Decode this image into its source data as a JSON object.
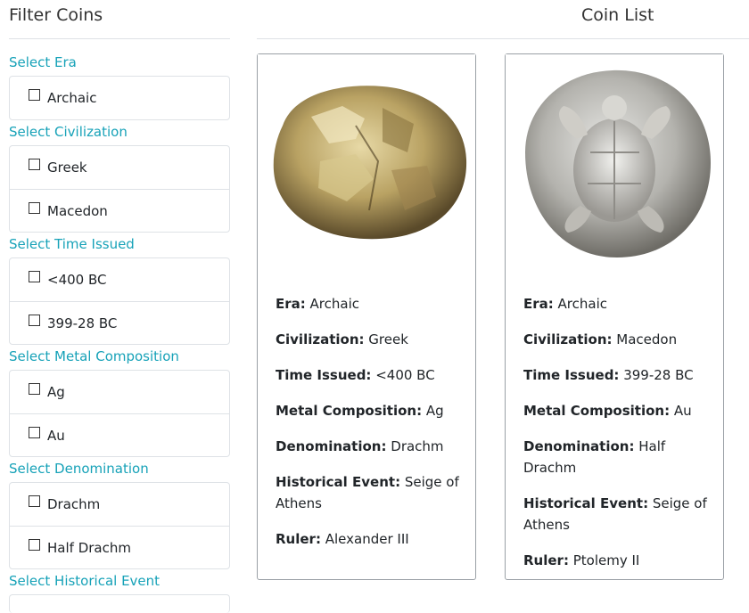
{
  "sidebar": {
    "title": "Filter Coins",
    "groups": [
      {
        "heading": "Select Era",
        "options": [
          "Archaic"
        ]
      },
      {
        "heading": "Select Civilization",
        "options": [
          "Greek",
          "Macedon"
        ]
      },
      {
        "heading": "Select Time Issued",
        "options": [
          "<400 BC",
          "399-28 BC"
        ]
      },
      {
        "heading": "Select Metal Composition",
        "options": [
          "Ag",
          "Au"
        ]
      },
      {
        "heading": "Select Denomination",
        "options": [
          "Drachm",
          "Half Drachm"
        ]
      },
      {
        "heading": "Select Historical Event",
        "options": []
      }
    ]
  },
  "main": {
    "title": "Coin List",
    "cards": [
      {
        "image_icon": "gold-lump-coin",
        "fields": [
          {
            "label": "Era:",
            "value": "Archaic"
          },
          {
            "label": "Civilization:",
            "value": "Greek"
          },
          {
            "label": "Time Issued:",
            "value": "<400 BC"
          },
          {
            "label": "Metal Composition:",
            "value": "Ag"
          },
          {
            "label": "Denomination:",
            "value": "Drachm"
          },
          {
            "label": "Historical Event:",
            "value": "Seige of Athens"
          },
          {
            "label": "Ruler:",
            "value": "Alexander III"
          }
        ]
      },
      {
        "image_icon": "silver-turtle-coin",
        "fields": [
          {
            "label": "Era:",
            "value": "Archaic"
          },
          {
            "label": "Civilization:",
            "value": "Macedon"
          },
          {
            "label": "Time Issued:",
            "value": "399-28 BC"
          },
          {
            "label": "Metal Composition:",
            "value": "Au"
          },
          {
            "label": "Denomination:",
            "value": "Half Drachm"
          },
          {
            "label": "Historical Event:",
            "value": "Seige of Athens"
          },
          {
            "label": "Ruler:",
            "value": "Ptolemy II"
          }
        ]
      }
    ]
  },
  "colors": {
    "accent": "#17a2b8",
    "border": "#dee2e6",
    "card_border": "#9aa0a6"
  }
}
